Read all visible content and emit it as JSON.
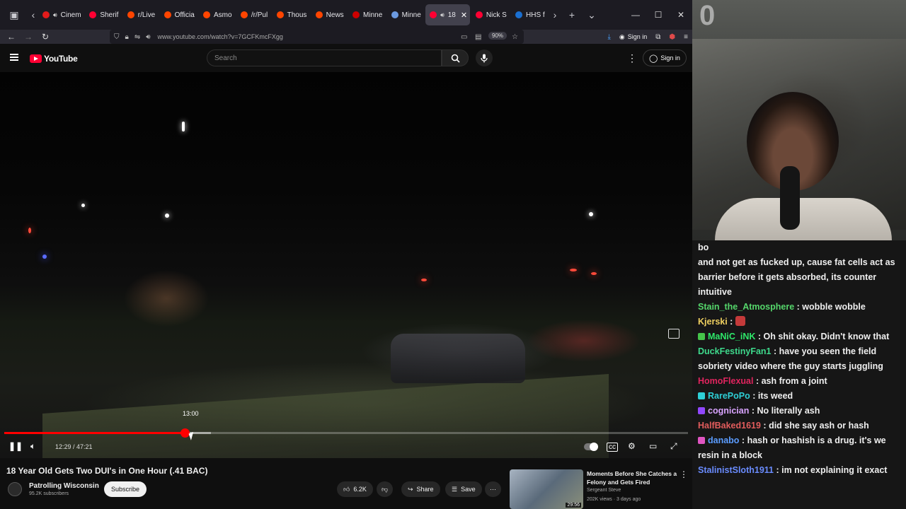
{
  "browser": {
    "tabs": [
      {
        "label": "Cinem",
        "color": "#e21b1b",
        "audio": true
      },
      {
        "label": "Sherif",
        "color": "#ff0033"
      },
      {
        "label": "r/Live",
        "color": "#ff4500"
      },
      {
        "label": "Officia",
        "color": "#ff4500"
      },
      {
        "label": "Asmo",
        "color": "#ff4500"
      },
      {
        "label": "/r/Pul",
        "color": "#ff4500"
      },
      {
        "label": "Thous",
        "color": "#ff4500"
      },
      {
        "label": "News",
        "color": "#ff4500"
      },
      {
        "label": "Minne",
        "color": "#cc0000"
      },
      {
        "label": "Minne",
        "color": "#6c9ae0"
      },
      {
        "label": "18",
        "color": "#ff0033",
        "audio": true,
        "active": true
      },
      {
        "label": "Nick S",
        "color": "#ff0033"
      },
      {
        "label": "HHS f",
        "color": "#1a6fd1"
      }
    ],
    "url": "www.youtube.com/watch?v=7GCFKmcFXgg",
    "zoom": "90%",
    "signin_label": "Sign in"
  },
  "youtube": {
    "logo_text": "YouTube",
    "search_placeholder": "Search",
    "signin_label": "Sign in"
  },
  "player": {
    "hover_time": "13:00",
    "current_time": "12:29",
    "duration": "47:21",
    "time_display": "12:29 / 47:21",
    "progress_fraction": 0.264,
    "buffer_fraction": 0.302,
    "colors": {
      "played": "#ff0000",
      "accent": "#ff0033"
    }
  },
  "video": {
    "title": "18 Year Old Gets Two DUI's in One Hour (.41 BAC)",
    "channel": "Patrolling Wisconsin",
    "subscribers": "95.2K subscribers",
    "subscribe_label": "Subscribe",
    "likes": "6.2K",
    "share_label": "Share",
    "save_label": "Save"
  },
  "recommended": {
    "title": "Moments Before She Catches a Felony and Gets Fired",
    "channel": "Sergeant Steve",
    "meta": "202K views · 3 days ago",
    "duration": "29:56"
  },
  "webcam": {
    "overlay_number": "0"
  },
  "chat": [
    {
      "user": "",
      "text": "bo",
      "color": "#efefef"
    },
    {
      "user": "",
      "text": "and not get as fucked up, cause fat cells act as barrier before it gets absorbed, its counter intuitive",
      "color": "#efefef"
    },
    {
      "user": "Stain_the_Atmosphere",
      "text": "wobble wobble",
      "color": "#55d66b"
    },
    {
      "user": "Kjerski",
      "text": "",
      "color": "#f0d060",
      "emote": true
    },
    {
      "user": "MaNiC_iNK",
      "text": "Oh shit okay. Didn't know that",
      "color": "#2ee86a",
      "badge": "#45c44a"
    },
    {
      "user": "DuckFestinyFan1",
      "text": "have you seen the field sobriety video where the guy starts juggling",
      "color": "#3ed98c"
    },
    {
      "user": "HomoFlexual",
      "text": "ash from a joint",
      "color": "#e0245e"
    },
    {
      "user": "RarePoPo",
      "text": "its weed",
      "color": "#2ecfd6",
      "badge": "#2ecfd6"
    },
    {
      "user": "cognician",
      "text": "No literally ash",
      "color": "#d9a4ff",
      "badge": "#9147ff"
    },
    {
      "user": "HalfBaked1619",
      "text": "did she say ash or hash",
      "color": "#e15c5c"
    },
    {
      "user": "danabo",
      "text": "hash or hashish is a drug. it's we resin in a block",
      "color": "#5b9cff",
      "badge": "#e055c2"
    },
    {
      "user": "StalinistSloth1911",
      "text": "im not explaining it exact",
      "color": "#6a8cff"
    }
  ]
}
